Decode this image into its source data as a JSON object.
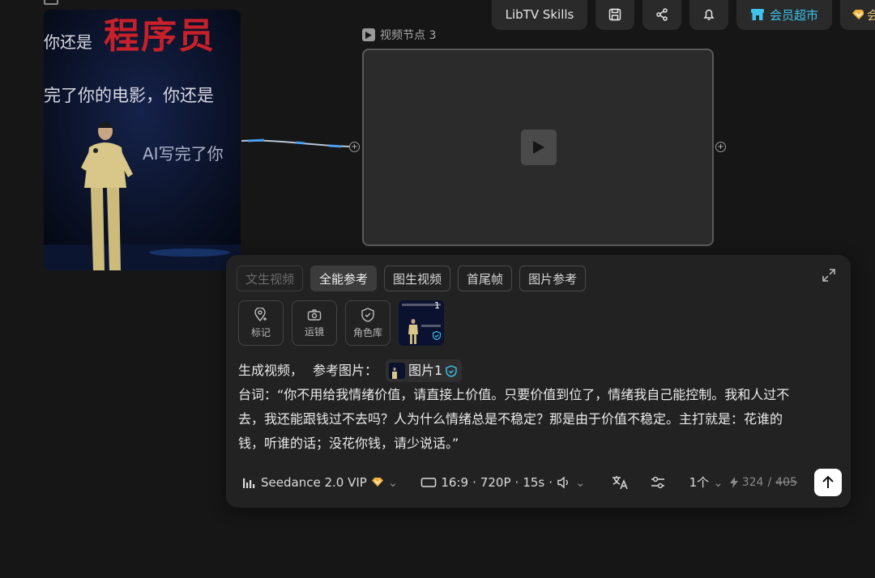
{
  "image_node": {
    "overlay_title": "程序员",
    "overlay_prefix": "你还是",
    "overlay_line2": "完了你的电影，你还是",
    "overlay_line3": "AI写完了你"
  },
  "video_node": {
    "label": "视频节点 3"
  },
  "topbar": {
    "skills_label": "LibTV Skills",
    "vip_label": "会员超市",
    "extra_label": "会"
  },
  "panel": {
    "tabs": [
      {
        "label": "文生视频",
        "state": "disabled"
      },
      {
        "label": "全能参考",
        "state": "active"
      },
      {
        "label": "图生视频",
        "state": "normal"
      },
      {
        "label": "首尾帧",
        "state": "normal"
      },
      {
        "label": "图片参考",
        "state": "normal"
      }
    ],
    "tools": [
      {
        "label": "标记",
        "icon": "location-pin-icon"
      },
      {
        "label": "运镜",
        "icon": "camera-icon"
      },
      {
        "label": "角色库",
        "icon": "shield-icon"
      }
    ],
    "ref_thumb_index": "1",
    "prompt": {
      "prefix": "生成视频，",
      "ref_label": "参考图片：",
      "chip_label": "图片1",
      "line2": "台词：“你不用给我情绪价值，请直接上价值。只要价值到位了，情绪我自己能控制。我和人过不",
      "line3": "去，我还能跟钱过不去吗？人为什么情绪总是不稳定？那是由于价值不稳定。主打就是：花谁的",
      "line4": "钱，听谁的话；没花你钱，请少说话。”"
    },
    "bottom": {
      "model": "Seedance 2.0 VIP",
      "ratio": "16:9",
      "resolution": "720P",
      "duration": "15s",
      "count": "1个",
      "credits_current": "324",
      "credits_separator": "/",
      "credits_original": "405"
    }
  },
  "colors": {
    "accent_cyan": "#3ec3ee",
    "vip_gold": "#f0b43c",
    "title_red": "#c8202a"
  }
}
